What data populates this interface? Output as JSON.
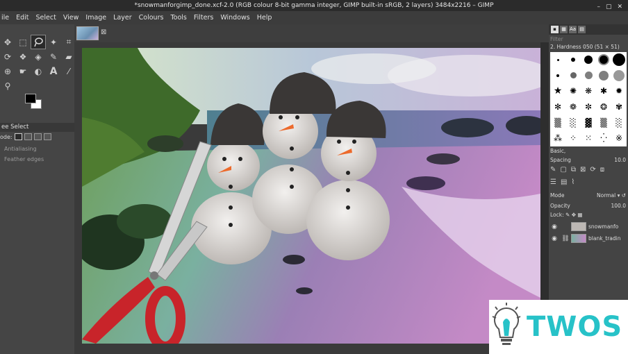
{
  "window": {
    "title": "*snowmanforgimp_done.xcf-2.0 (RGB colour 8-bit gamma integer, GIMP built-in sRGB, 2 layers) 3484x2216 – GIMP",
    "controls": [
      "–",
      "▢",
      "✕"
    ]
  },
  "menu": [
    "ile",
    "Edit",
    "Select",
    "View",
    "Image",
    "Layer",
    "Colours",
    "Tools",
    "Filters",
    "Windows",
    "Help"
  ],
  "toolbox": {
    "tools": [
      "move-icon",
      "rect-select-icon",
      "lasso-icon",
      "fuzzy-select-icon",
      "crop-icon",
      "rotate-icon",
      "warp-icon",
      "paint-bucket-icon",
      "pencil-icon",
      "eraser-icon",
      "clone-icon",
      "smudge-icon",
      "dodge-icon",
      "text-icon",
      "color-picker-icon",
      "zoom-icon"
    ],
    "active_tool_index": 2,
    "options_title": "ee Select",
    "mode_label": "ode:",
    "antialiasing_label": "Antialiasing",
    "feather_label": "Feather edges"
  },
  "dock": {
    "filter_placeholder": "Filter",
    "brush_name": "2. Hardness 050 (51 × 51)",
    "brush_preset": "Basic,",
    "spacing_label": "Spacing",
    "spacing_value": "10.0",
    "mode_label": "Mode",
    "mode_value": "Normal",
    "opacity_label": "Opacity",
    "opacity_value": "100.0",
    "lock_label": "Lock:",
    "layers": [
      {
        "name": "snowmanfo",
        "visible": true
      },
      {
        "name": "blank_tradin",
        "visible": true
      }
    ]
  },
  "watermark": {
    "text": "TWOS"
  }
}
